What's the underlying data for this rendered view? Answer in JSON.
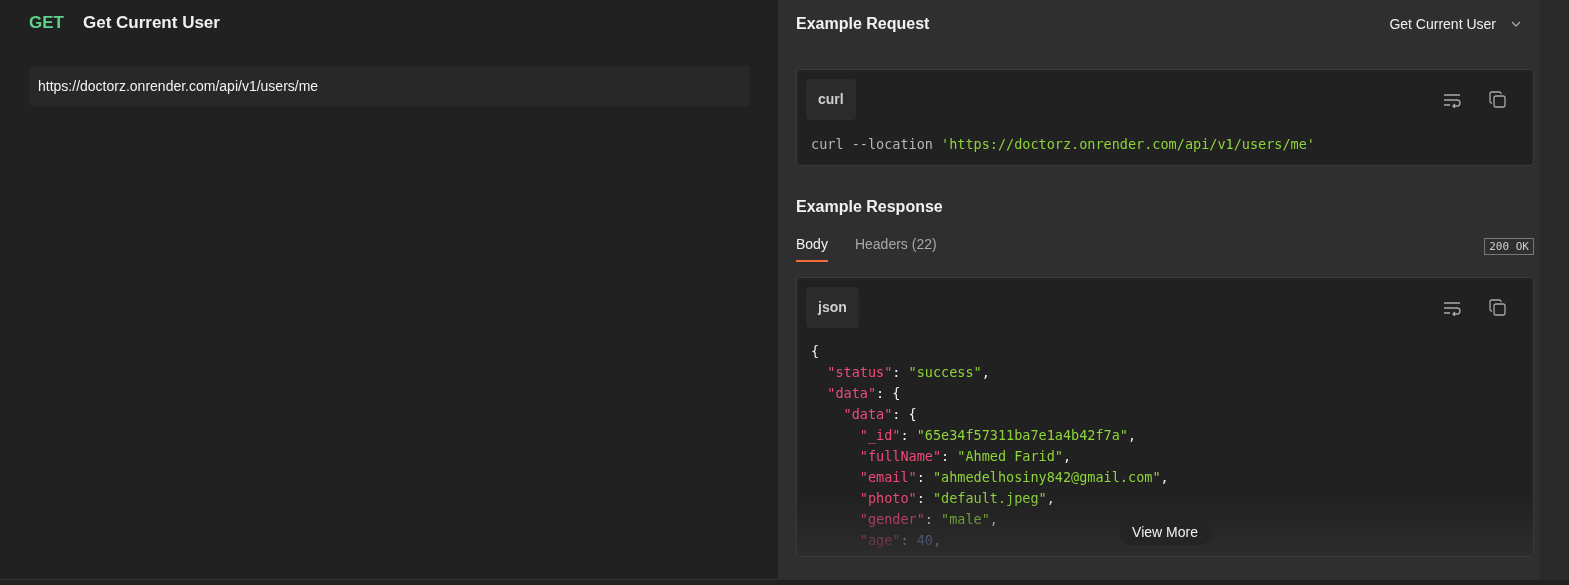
{
  "request": {
    "method": "GET",
    "title": "Get Current User",
    "url": "https://doctorz.onrender.com/api/v1/users/me"
  },
  "example_request": {
    "heading": "Example Request",
    "dropdown": "Get Current User",
    "language": "curl",
    "code": [
      [
        {
          "kind": "plain",
          "t": "curl --location "
        },
        {
          "kind": "string",
          "t": "'https://doctorz.onrender.com/api/v1/users/me'"
        }
      ]
    ]
  },
  "example_response": {
    "heading": "Example Response",
    "tabs": [
      {
        "label": "Body",
        "selected": true
      },
      {
        "label": "Headers (22)",
        "selected": false
      }
    ],
    "status_badge": "200 OK",
    "language": "json",
    "code": [
      [
        {
          "kind": "punct",
          "t": "{"
        }
      ],
      [
        {
          "kind": "key",
          "t": "  \"status\""
        },
        {
          "kind": "punct",
          "t": ": "
        },
        {
          "kind": "string",
          "t": "\"success\""
        },
        {
          "kind": "punct",
          "t": ","
        }
      ],
      [
        {
          "kind": "key",
          "t": "  \"data\""
        },
        {
          "kind": "punct",
          "t": ": {"
        }
      ],
      [
        {
          "kind": "key",
          "t": "    \"data\""
        },
        {
          "kind": "punct",
          "t": ": {"
        }
      ],
      [
        {
          "kind": "key",
          "t": "      \"_id\""
        },
        {
          "kind": "punct",
          "t": ": "
        },
        {
          "kind": "string",
          "t": "\"65e34f57311ba7e1a4b42f7a\""
        },
        {
          "kind": "punct",
          "t": ","
        }
      ],
      [
        {
          "kind": "key",
          "t": "      \"fullName\""
        },
        {
          "kind": "punct",
          "t": ": "
        },
        {
          "kind": "string",
          "t": "\"Ahmed Farid\""
        },
        {
          "kind": "punct",
          "t": ","
        }
      ],
      [
        {
          "kind": "key",
          "t": "      \"email\""
        },
        {
          "kind": "punct",
          "t": ": "
        },
        {
          "kind": "string",
          "t": "\"ahmedelhosiny842@gmail.com\""
        },
        {
          "kind": "punct",
          "t": ","
        }
      ],
      [
        {
          "kind": "key",
          "t": "      \"photo\""
        },
        {
          "kind": "punct",
          "t": ": "
        },
        {
          "kind": "string",
          "t": "\"default.jpeg\""
        },
        {
          "kind": "punct",
          "t": ","
        }
      ],
      [
        {
          "kind": "key",
          "t": "      \"gender\""
        },
        {
          "kind": "punct",
          "t": ": "
        },
        {
          "kind": "string",
          "t": "\"male\""
        },
        {
          "kind": "punct",
          "t": ","
        }
      ],
      [
        {
          "kind": "key",
          "t": "      \"age\""
        },
        {
          "kind": "punct",
          "t": ": "
        },
        {
          "kind": "number",
          "t": "40"
        },
        {
          "kind": "punct",
          "t": ","
        }
      ]
    ],
    "view_more": "View More"
  }
}
